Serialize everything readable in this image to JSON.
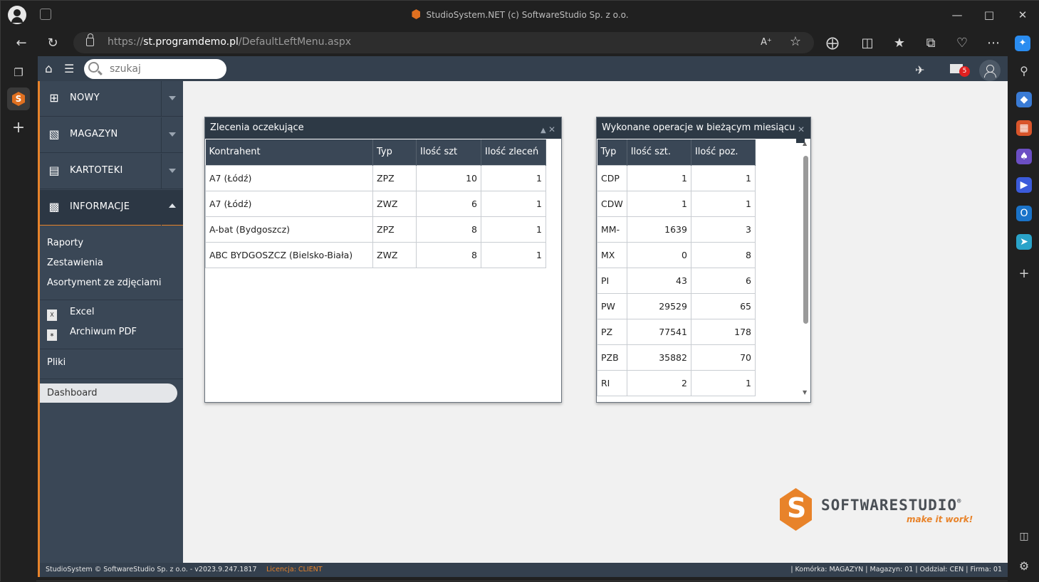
{
  "browser": {
    "title": "StudioSystem.NET (c) SoftwareStudio Sp. z o.o.",
    "url_prefix": "https://",
    "url_host": "st.programdemo.pl",
    "url_path": "/DefaultLeftMenu.aspx"
  },
  "header": {
    "search_placeholder": "szukaj",
    "mail_count": "5"
  },
  "sidebar": {
    "sections": [
      {
        "label": "NOWY",
        "icon": "plus-box-icon"
      },
      {
        "label": "MAGAZYN",
        "icon": "warehouse-icon"
      },
      {
        "label": "KARTOTEKI",
        "icon": "card-icon"
      },
      {
        "label": "INFORMACJE",
        "icon": "document-icon"
      }
    ],
    "links": [
      "Raporty",
      "Zestawienia",
      "Asortyment ze zdjęciami"
    ],
    "files": [
      "Excel",
      "Archiwum PDF"
    ],
    "pliki": "Pliki",
    "dashboard": "Dashboard"
  },
  "widgets": {
    "orders": {
      "title": "Zlecenia oczekujące",
      "columns": [
        "Kontrahent",
        "Typ",
        "Ilość szt",
        "Ilość zleceń"
      ],
      "rows": [
        [
          "A7 (Łódź)",
          "ZPZ",
          "10",
          "1"
        ],
        [
          "A7 (Łódź)",
          "ZWZ",
          "6",
          "1"
        ],
        [
          "A-bat (Bydgoszcz)",
          "ZPZ",
          "8",
          "1"
        ],
        [
          "ABC BYDGOSZCZ (Bielsko-Biała)",
          "ZWZ",
          "8",
          "1"
        ]
      ]
    },
    "ops": {
      "title": "Wykonane operacje w bieżącym miesiącu",
      "columns": [
        "Typ",
        "Ilość szt.",
        "Ilość poz."
      ],
      "rows": [
        [
          "CDP",
          "1",
          "1"
        ],
        [
          "CDW",
          "1",
          "1"
        ],
        [
          "MM-",
          "1639",
          "3"
        ],
        [
          "MX",
          "0",
          "8"
        ],
        [
          "PI",
          "43",
          "6"
        ],
        [
          "PW",
          "29529",
          "65"
        ],
        [
          "PZ",
          "77541",
          "178"
        ],
        [
          "PZB",
          "35882",
          "70"
        ],
        [
          "RI",
          "2",
          "1"
        ]
      ]
    }
  },
  "logo": {
    "name": "SOFTWARESTUDIO",
    "tagline": "make it work!",
    "registered": "®"
  },
  "footer": {
    "copyright": "StudioSystem © SoftwareStudio Sp. z o.o. - v2023.9.247.1817",
    "license": "Licencja: CLIENT",
    "status": "| Komórka: MAGAZYN | Magazyn: 01 | Oddział: CEN | Firma: 01"
  }
}
